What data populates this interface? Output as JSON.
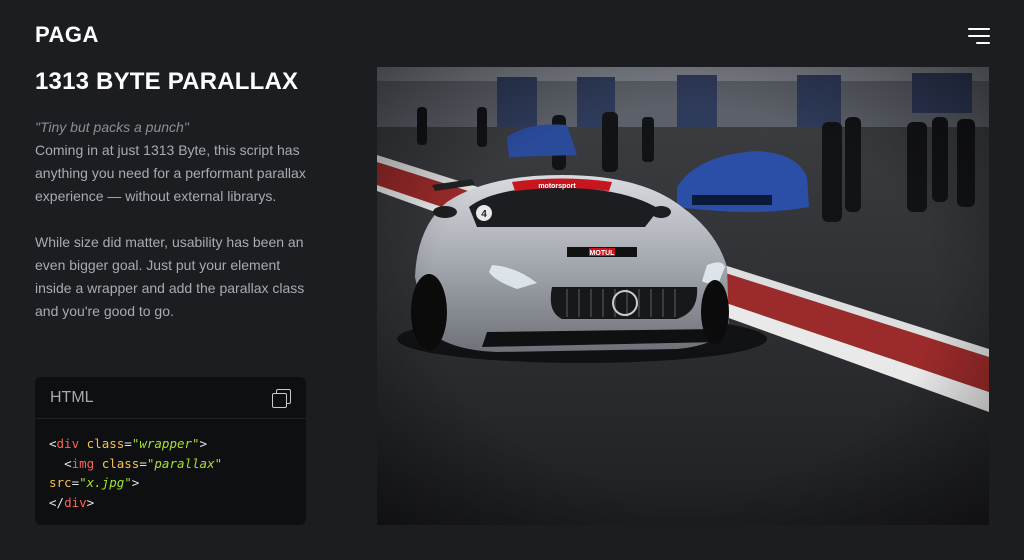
{
  "header": {
    "logo": "PAGA",
    "menu_icon": "hamburger-menu-icon"
  },
  "main": {
    "title": "1313 BYTE PARALLAX",
    "quote": "\"Tiny but packs a punch\"",
    "paragraph1": "Coming in at just 1313 Byte, this script has anything you need for a performant parallax experience — without external librarys.",
    "paragraph2": "While size did matter, usability has been an even bigger goal. Just put your element inside a wrapper and add the parallax class and you're good to go."
  },
  "code": {
    "language": "HTML",
    "copy_icon": "copy-icon",
    "line1": {
      "open": "<",
      "tag": "div",
      "attr": "class",
      "eq": "=",
      "value": "\"wrapper\"",
      "close": ">"
    },
    "line2": {
      "open": "<",
      "tag": "img",
      "attr": "class",
      "eq": "=",
      "value": "\"parallax\""
    },
    "line3": {
      "attr": "src",
      "eq": "=",
      "value": "\"x.jpg\"",
      "close": ">"
    },
    "line4": {
      "open": "</",
      "tag": "div",
      "close": ">"
    }
  },
  "image": {
    "plate_brand": "motorsport",
    "sponsor": "MOTUL",
    "number": "4"
  },
  "colors": {
    "background": "#1b1d21",
    "code_bg": "#0e0f11",
    "tag": "#ff5f55",
    "attr": "#f7c14a",
    "string": "#a6e22e"
  }
}
